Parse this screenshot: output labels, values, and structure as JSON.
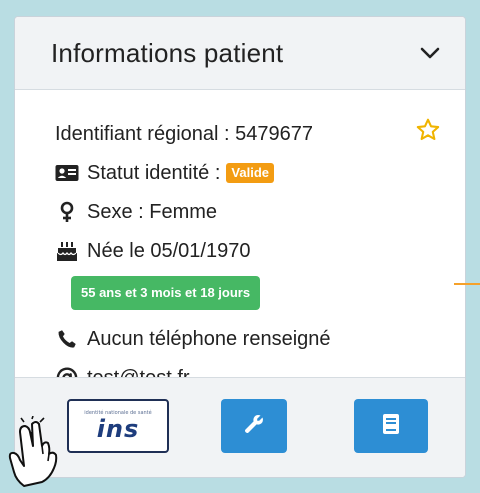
{
  "header": {
    "title": "Informations patient"
  },
  "patient": {
    "identifiant": "Identifiant régional : 5479677",
    "statut_label": "Statut identité :",
    "statut_badge": "Valide",
    "sexe": "Sexe : Femme",
    "naissance": "Née le 05/01/1970",
    "age": "55 ans et 3 mois et 18 jours",
    "telephone": "Aucun téléphone renseigné",
    "email": "test@test.fr"
  },
  "footer": {
    "ins_small": "identité nationale de santé",
    "ins_logo": "ins"
  },
  "icons": {
    "chevron": "chevron-down-icon",
    "star": "star-icon",
    "id_card": "id-card-icon",
    "gender": "female-icon",
    "cake": "birthday-cake-icon",
    "phone": "phone-icon",
    "at": "at-icon",
    "wrench": "wrench-icon",
    "book": "book-icon",
    "hand": "hand-pointer-icon"
  },
  "colors": {
    "valide_badge": "#f39c12",
    "age_badge": "#46b864",
    "action_button": "#2d8ed4",
    "star": "#f0b400",
    "ins_border": "#1f2f55"
  }
}
